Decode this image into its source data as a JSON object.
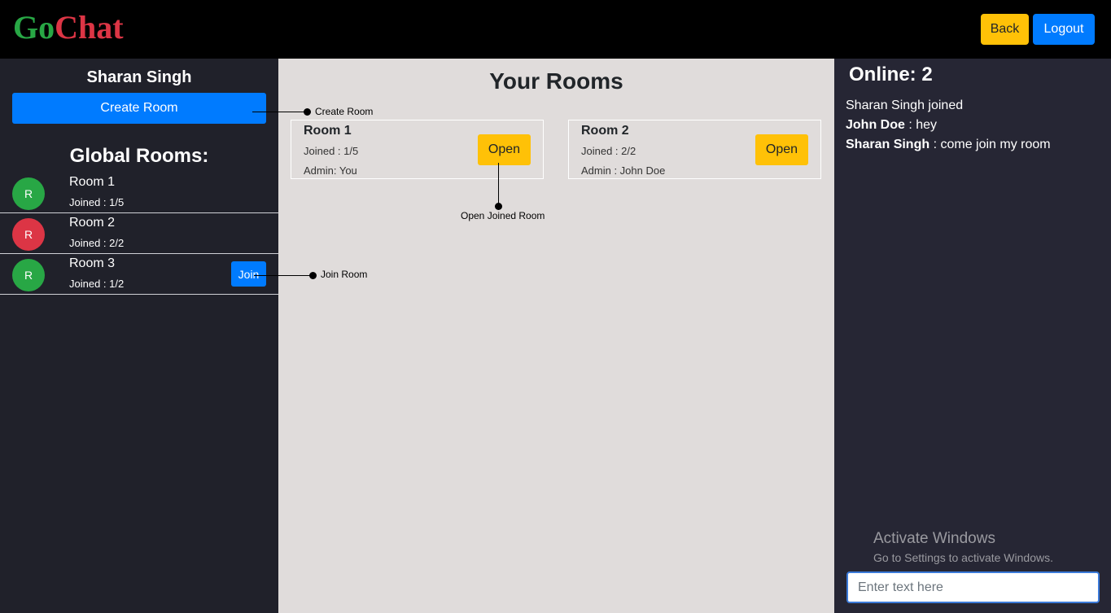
{
  "header": {
    "logo_part1": "Go",
    "logo_part2": "Chat",
    "back_label": "Back",
    "logout_label": "Logout"
  },
  "sidebar": {
    "username": "Sharan Singh",
    "create_room_label": "Create Room",
    "global_title": "Global Rooms:",
    "rooms": [
      {
        "avatar": "R",
        "avatar_color": "#28a745",
        "name": "Room 1",
        "joined": "Joined : 1/5"
      },
      {
        "avatar": "R",
        "avatar_color": "#dc3545",
        "name": "Room 2",
        "joined": "Joined : 2/2"
      },
      {
        "avatar": "R",
        "avatar_color": "#28a745",
        "name": "Room 3",
        "joined": "Joined : 1/2",
        "join_label": "Join"
      }
    ]
  },
  "main": {
    "title": "Your Rooms",
    "cards": [
      {
        "name": "Room 1",
        "joined": "Joined : 1/5",
        "admin": "Admin: You",
        "open_label": "Open"
      },
      {
        "name": "Room 2",
        "joined": "Joined : 2/2",
        "admin": "Admin : John Doe",
        "open_label": "Open"
      }
    ]
  },
  "chat": {
    "online": "Online: 2",
    "messages": [
      {
        "sender": "",
        "text": "Sharan Singh joined"
      },
      {
        "sender": "John Doe",
        "text": " : hey"
      },
      {
        "sender": "Sharan Singh",
        "text": " : come join my room"
      }
    ],
    "input_placeholder": "Enter text here"
  },
  "watermark": {
    "line1": "Activate Windows",
    "line2": "Go to Settings to activate Windows."
  },
  "annotations": {
    "create_room": "Create Room",
    "open_joined_room": "Open Joined Room",
    "join_room": "Join Room"
  },
  "colors": {
    "brand_green": "#28a745",
    "brand_red": "#dc3545",
    "primary": "#007bff",
    "warning": "#ffc107"
  }
}
